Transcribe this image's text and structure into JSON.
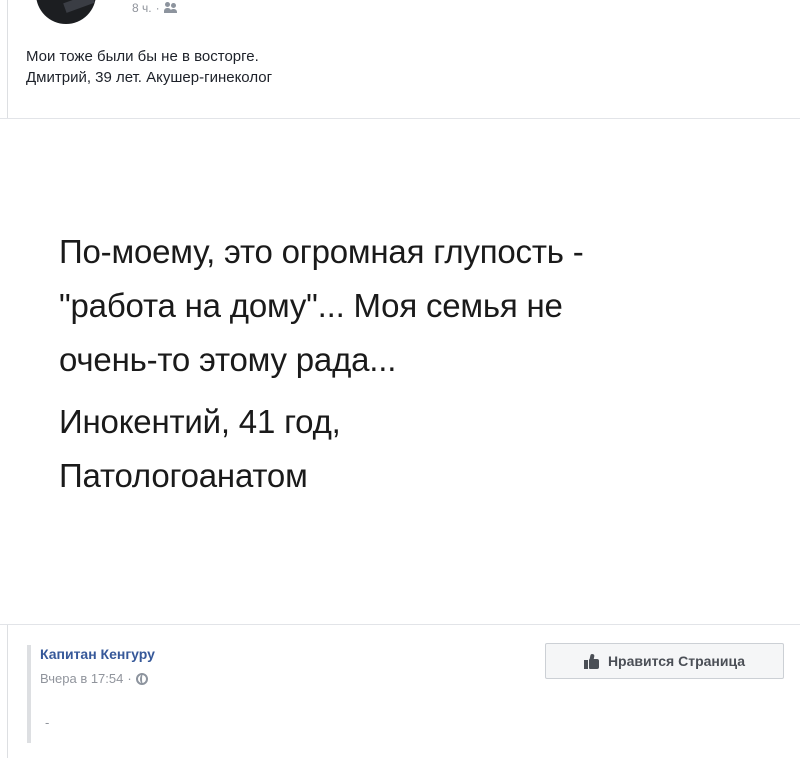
{
  "post": {
    "time": "8 ч.",
    "separator": "·",
    "audience_icon": "friends-icon",
    "caption_lines": [
      "Мои тоже были бы не в восторге.",
      "Дмитрий, 39 лет. Акушер-гинеколог"
    ]
  },
  "image": {
    "quote_lines": [
      "По-моему, это огромная глупость -",
      "\"работа на дому\"... Моя семья не",
      "очень-то этому рада..."
    ],
    "author_lines": [
      "Инокентий, 41 год,",
      "Патологоанатом"
    ]
  },
  "attribution": {
    "page_name": "Капитан Кенгуру",
    "time": "Вчера в 17:54",
    "separator": "·",
    "privacy_icon": "globe-icon",
    "like_button_label": "Нравится Страница",
    "like_button_icon": "thumbs-up-icon",
    "trailing_text": "-"
  },
  "colors": {
    "link": "#365899",
    "meta": "#90949c",
    "text": "#1d2129",
    "button_bg": "#f5f6f7"
  }
}
